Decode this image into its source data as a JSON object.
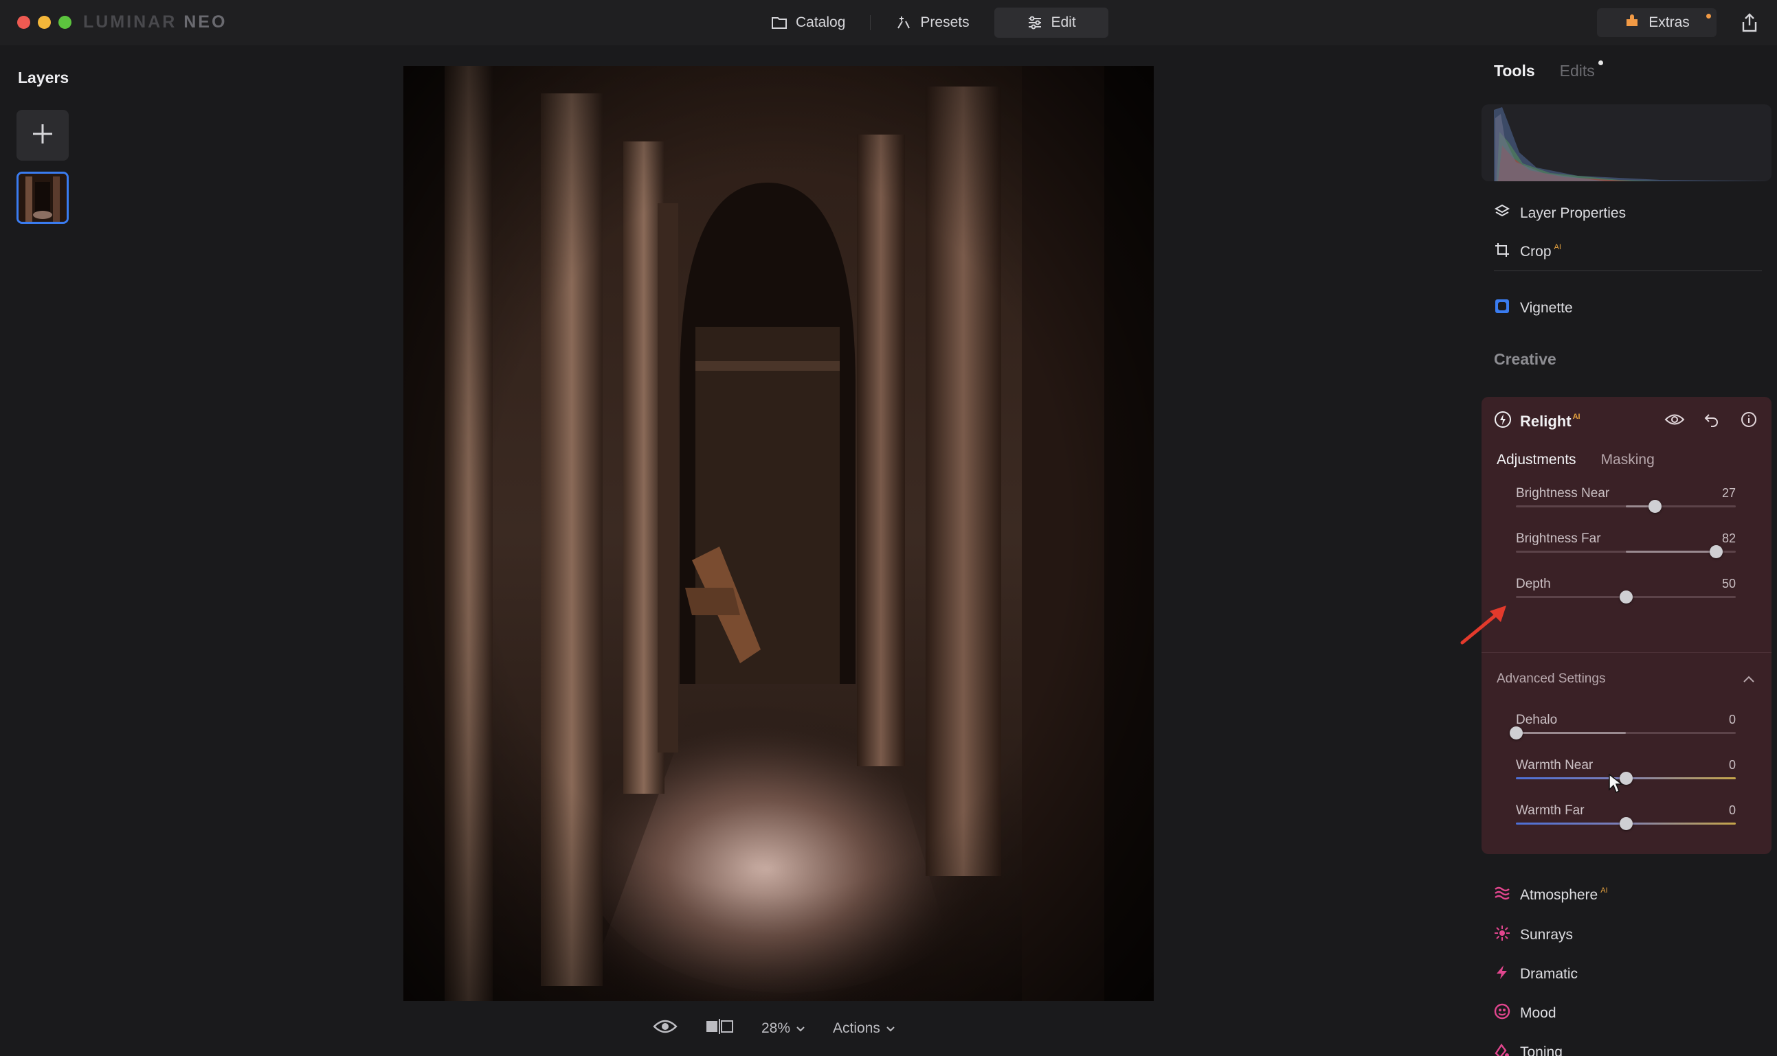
{
  "app": {
    "brand_main": "LUMINAR",
    "brand_neo": "NEO"
  },
  "top_nav": {
    "catalog": "Catalog",
    "presets": "Presets",
    "edit": "Edit",
    "extras": "Extras"
  },
  "left_panel": {
    "title": "Layers",
    "add_icon": "plus-icon"
  },
  "bottom_bar": {
    "zoom": "28%",
    "actions": "Actions"
  },
  "right_panel": {
    "tabs": {
      "tools": "Tools",
      "edits": "Edits"
    },
    "tools": {
      "layer_properties": "Layer Properties",
      "crop": "Crop",
      "crop_badge": "AI",
      "vignette": "Vignette"
    },
    "section_creative": "Creative",
    "relight": {
      "title": "Relight",
      "badge": "AI",
      "tab_adjustments": "Adjustments",
      "tab_masking": "Masking",
      "advanced_settings": "Advanced Settings",
      "sliders": [
        {
          "label": "Brightness Near",
          "value": "27",
          "level": 0.63,
          "type": "plain"
        },
        {
          "label": "Brightness Far",
          "value": "82",
          "level": 0.91,
          "type": "plain"
        },
        {
          "label": "Depth",
          "value": "50",
          "level": 0.5,
          "type": "plain"
        }
      ],
      "advanced_sliders": [
        {
          "label": "Dehalo",
          "value": "0",
          "level": 0.0,
          "type": "plain"
        },
        {
          "label": "Warmth Near",
          "value": "0",
          "level": 0.5,
          "type": "warm"
        },
        {
          "label": "Warmth Far",
          "value": "0",
          "level": 0.5,
          "type": "warm"
        }
      ]
    },
    "creative_tools": [
      {
        "label": "Atmosphere",
        "badge": "AI",
        "icon": "atmosphere-icon"
      },
      {
        "label": "Sunrays",
        "badge": "",
        "icon": "sunrays-icon"
      },
      {
        "label": "Dramatic",
        "badge": "",
        "icon": "dramatic-icon"
      },
      {
        "label": "Mood",
        "badge": "",
        "icon": "mood-icon"
      },
      {
        "label": "Toning",
        "badge": "",
        "icon": "toning-icon"
      }
    ]
  },
  "colors": {
    "accent_blue": "#3a7cf0",
    "relight_bg": "#3a2126",
    "creative_pink": "#e2468e",
    "arrow_red": "#e33a2c"
  }
}
